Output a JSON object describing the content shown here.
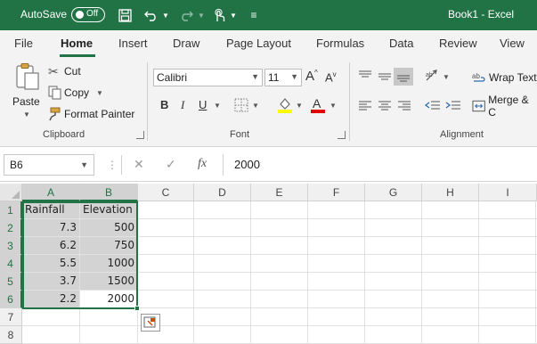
{
  "titlebar": {
    "autosave_label": "AutoSave",
    "autosave_state": "Off",
    "title": "Book1 - Excel"
  },
  "tabs": [
    {
      "label": "File"
    },
    {
      "label": "Home"
    },
    {
      "label": "Insert"
    },
    {
      "label": "Draw"
    },
    {
      "label": "Page Layout"
    },
    {
      "label": "Formulas"
    },
    {
      "label": "Data"
    },
    {
      "label": "Review"
    },
    {
      "label": "View"
    }
  ],
  "ribbon": {
    "clipboard": {
      "paste": "Paste",
      "cut": "Cut",
      "copy": "Copy",
      "format_painter": "Format Painter",
      "group_label": "Clipboard"
    },
    "font": {
      "font_name": "Calibri",
      "font_size": "11",
      "bold": "B",
      "italic": "I",
      "underline": "U",
      "font_color_letter": "A",
      "group_label": "Font"
    },
    "alignment": {
      "wrap_text": "Wrap Text",
      "merge": "Merge & C",
      "group_label": "Alignment"
    }
  },
  "formula_bar": {
    "name_box": "B6",
    "fx": "fx",
    "value": "2000"
  },
  "columns": [
    "A",
    "B",
    "C",
    "D",
    "E",
    "F",
    "G",
    "H",
    "I"
  ],
  "rows": [
    {
      "num": "1",
      "a": "Rainfall",
      "b": "Elevation"
    },
    {
      "num": "2",
      "a": "7.3",
      "b": "500"
    },
    {
      "num": "3",
      "a": "6.2",
      "b": "750"
    },
    {
      "num": "4",
      "a": "5.5",
      "b": "1000"
    },
    {
      "num": "5",
      "a": "3.7",
      "b": "1500"
    },
    {
      "num": "6",
      "a": "2.2",
      "b": "2000"
    },
    {
      "num": "7",
      "a": "",
      "b": ""
    },
    {
      "num": "8",
      "a": "",
      "b": ""
    }
  ],
  "colors": {
    "accent": "#217346",
    "selection_fill": "#d3d3d3"
  }
}
